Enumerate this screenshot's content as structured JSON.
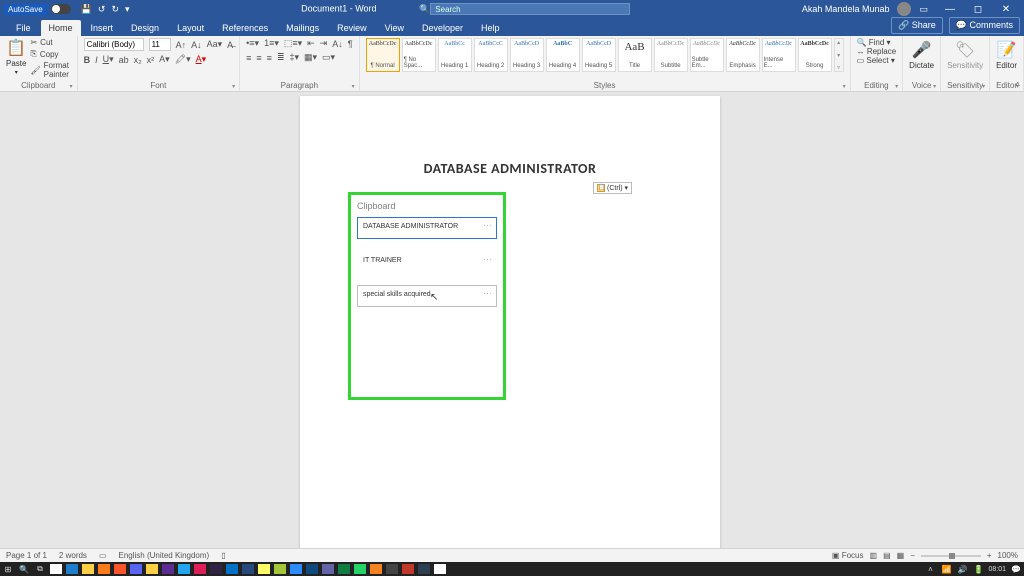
{
  "titlebar": {
    "autosave": "AutoSave",
    "doc_title": "Document1 - Word",
    "search_placeholder": "Search",
    "user": "Akah Mandela Munab"
  },
  "menu": {
    "tabs": [
      "File",
      "Home",
      "Insert",
      "Design",
      "Layout",
      "References",
      "Mailings",
      "Review",
      "View",
      "Developer",
      "Help"
    ],
    "share": "Share",
    "comments": "Comments"
  },
  "ribbon": {
    "clipboard": {
      "paste": "Paste",
      "cut": "Cut",
      "copy": "Copy",
      "fmt": "Format Painter",
      "label": "Clipboard"
    },
    "font": {
      "name": "Calibri (Body)",
      "size": "11",
      "label": "Font"
    },
    "paragraph": {
      "label": "Paragraph"
    },
    "styles": {
      "items": [
        {
          "sample": "AaBbCcDc",
          "name": "¶ Normal"
        },
        {
          "sample": "AaBbCcDc",
          "name": "¶ No Spac..."
        },
        {
          "sample": "AaBbCc",
          "name": "Heading 1"
        },
        {
          "sample": "AaBbCcC",
          "name": "Heading 2"
        },
        {
          "sample": "AaBbCcD",
          "name": "Heading 3"
        },
        {
          "sample": "AaBbC",
          "name": "Heading 4"
        },
        {
          "sample": "AaBbCcD",
          "name": "Heading 5"
        },
        {
          "sample": "AaB",
          "name": "Title"
        },
        {
          "sample": "AaBbCcDc",
          "name": "Subtitle"
        },
        {
          "sample": "AaBbCcDc",
          "name": "Subtle Em..."
        },
        {
          "sample": "AaBbCcDc",
          "name": "Emphasis"
        },
        {
          "sample": "AaBbCcDc",
          "name": "Intense E..."
        },
        {
          "sample": "AaBbCcDc",
          "name": "Strong"
        }
      ],
      "label": "Styles"
    },
    "editing": {
      "find": "Find",
      "replace": "Replace",
      "select": "Select",
      "label": "Editing"
    },
    "voice": {
      "dictate": "Dictate",
      "label": "Voice"
    },
    "sensitivity": {
      "btn": "Sensitivity",
      "label": "Sensitivity"
    },
    "editor": {
      "btn": "Editor",
      "label": "Editor"
    }
  },
  "document": {
    "heading": "DATABASE ADMINISTRATOR",
    "ctrl_badge": "(Ctrl) ▾"
  },
  "clipboard_pane": {
    "title": "Clipboard",
    "items": [
      "DATABASE ADMINISTRATOR",
      "IT TRAINER",
      "special skills acquired"
    ]
  },
  "status": {
    "page": "Page 1 of 1",
    "words": "2 words",
    "lang": "English (United Kingdom)",
    "focus": "Focus",
    "zoom": "100%"
  },
  "taskbar": {
    "clock": "08:01"
  }
}
